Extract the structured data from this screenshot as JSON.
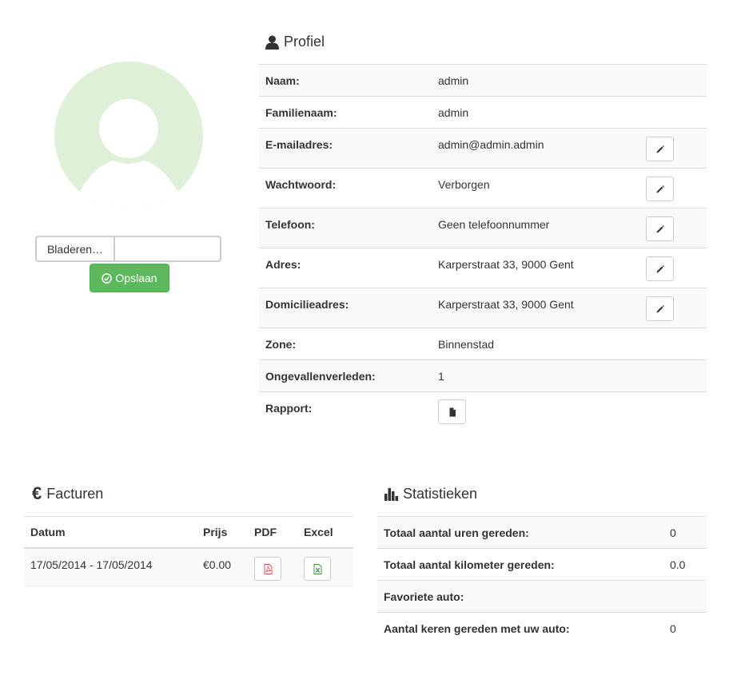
{
  "colors": {
    "success": "#5cb85c",
    "avatar": "#dff0d8",
    "border": "#dddddd",
    "stripe": "#f9f9f9",
    "pdf": "#d9534f",
    "excel": "#3c9a3c"
  },
  "upload": {
    "browse_label": "Bladeren…",
    "save_label": "Opslaan"
  },
  "profile": {
    "title": "Profiel",
    "rows": [
      {
        "label": "Naam:",
        "value": "admin"
      },
      {
        "label": "Familienaam:",
        "value": "admin"
      },
      {
        "label": "E-mailadres:",
        "value": "admin@admin.admin"
      },
      {
        "label": "Wachtwoord:",
        "value": "Verborgen"
      },
      {
        "label": "Telefoon:",
        "value": "Geen telefoonnummer"
      },
      {
        "label": "Adres:",
        "value": "Karperstraat 33, 9000 Gent"
      },
      {
        "label": "Domicilieadres:",
        "value": "Karperstraat 33, 9000 Gent"
      },
      {
        "label": "Zone:",
        "value": "Binnenstad"
      },
      {
        "label": "Ongevallenverleden:",
        "value": "1"
      },
      {
        "label": "Rapport:",
        "value": ""
      }
    ]
  },
  "invoices": {
    "title": "Facturen",
    "columns": [
      "Datum",
      "Prijs",
      "PDF",
      "Excel"
    ],
    "rows": [
      {
        "date": "17/05/2014 - 17/05/2014",
        "price": "€0.00"
      }
    ]
  },
  "stats": {
    "title": "Statistieken",
    "rows": [
      {
        "label": "Totaal aantal uren gereden:",
        "value": "0"
      },
      {
        "label": "Totaal aantal kilometer gereden:",
        "value": "0.0"
      },
      {
        "label": "Favoriete auto:",
        "value": ""
      },
      {
        "label": "Aantal keren gereden met uw auto:",
        "value": "0"
      }
    ]
  }
}
